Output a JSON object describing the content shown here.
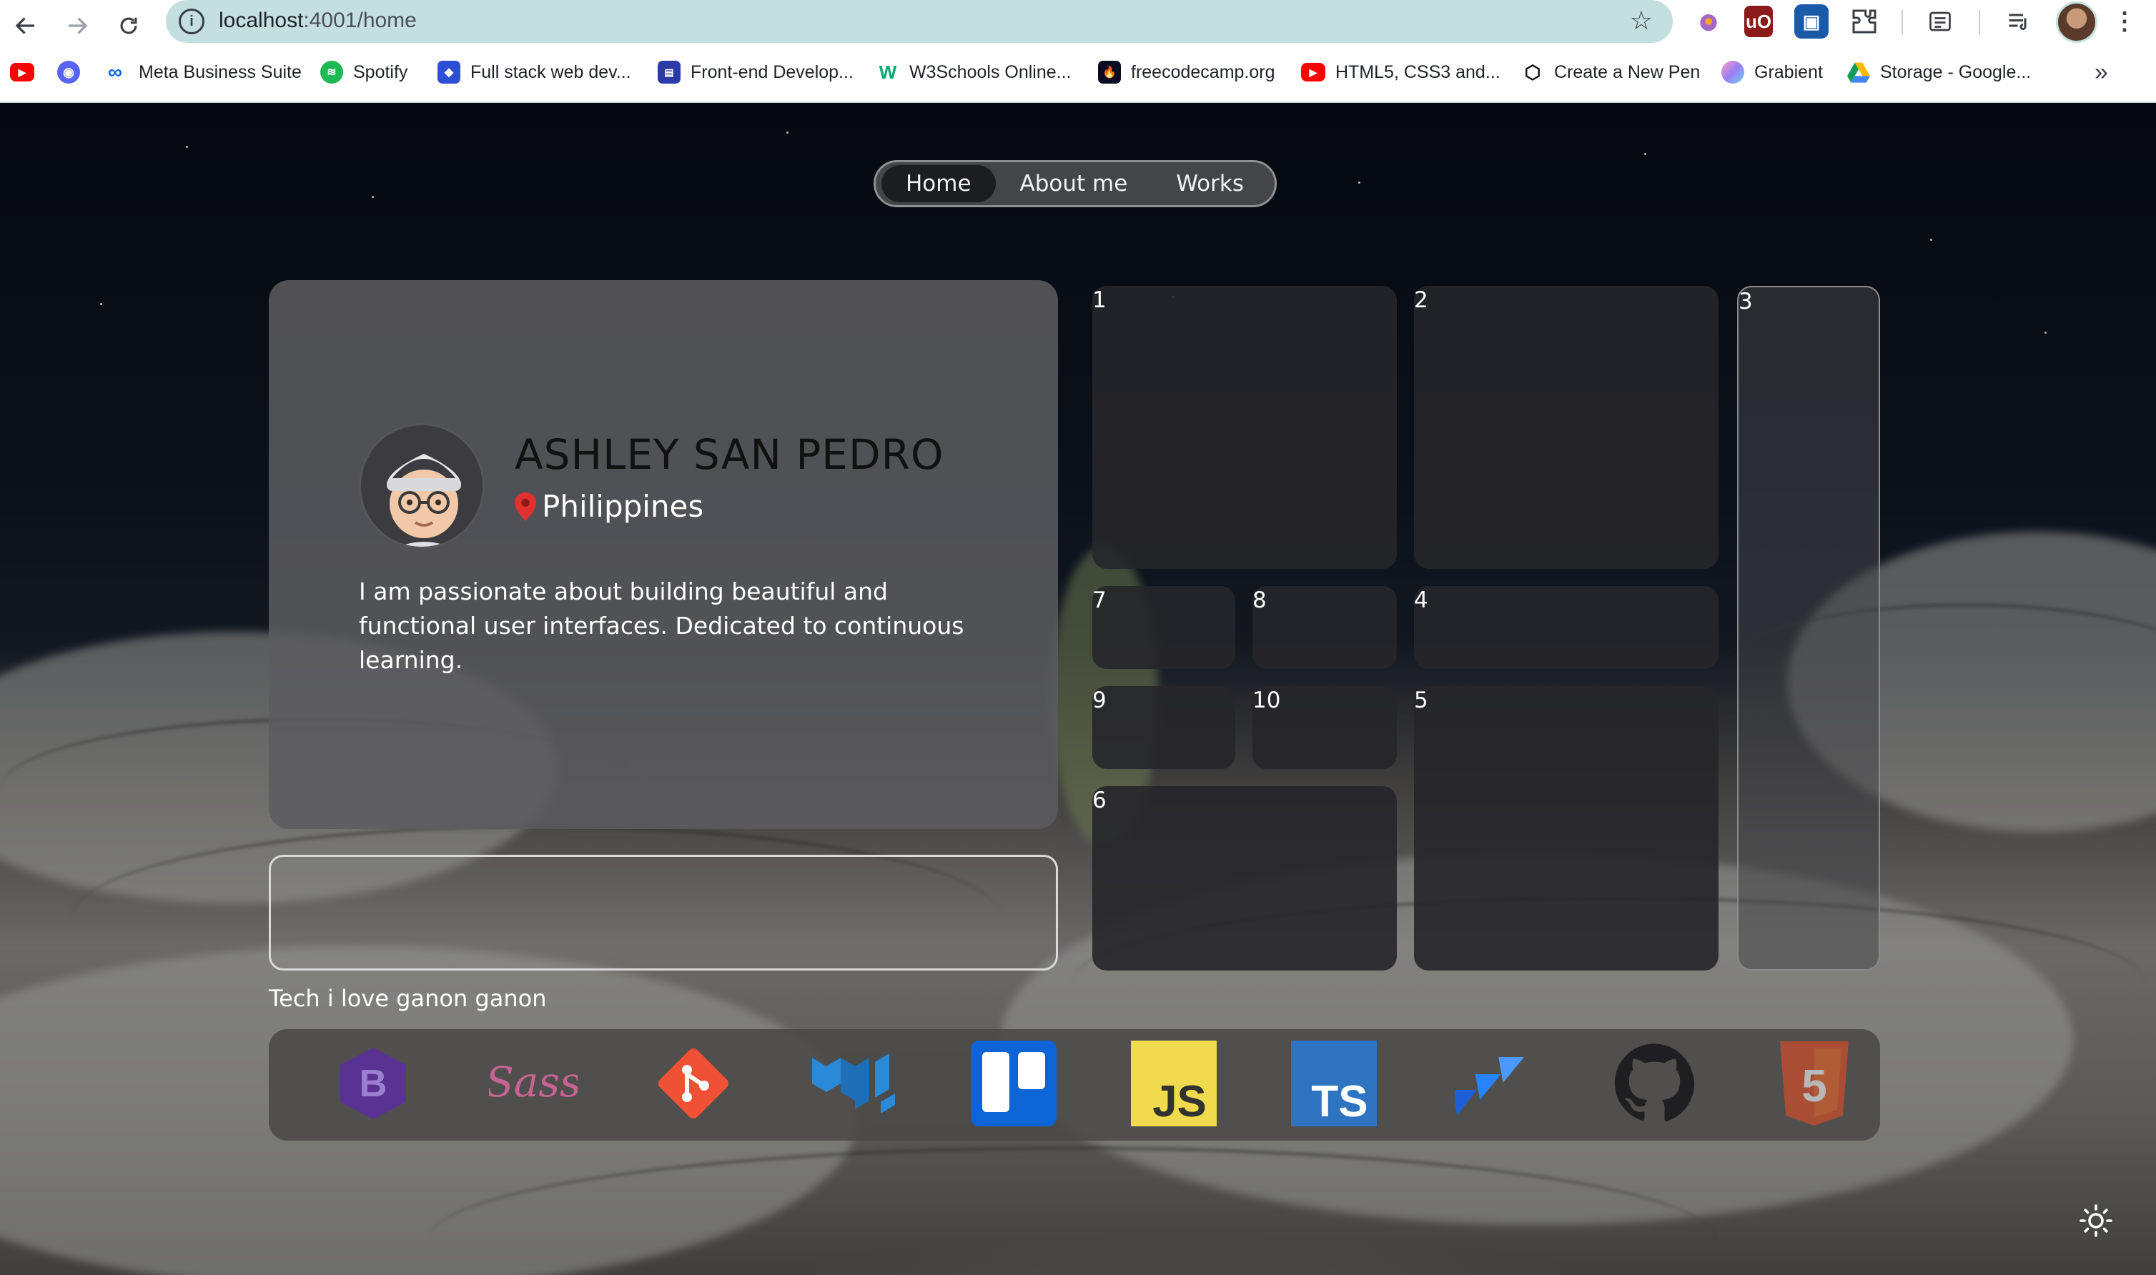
{
  "browser": {
    "url": {
      "host": "localhost",
      "path": ":4001/home"
    },
    "bookmarks": [
      {
        "label": ""
      },
      {
        "label": ""
      },
      {
        "label": "Meta Business Suite"
      },
      {
        "label": "Spotify"
      },
      {
        "label": "Full stack web dev..."
      },
      {
        "label": "Front-end Develop..."
      },
      {
        "label": "W3Schools Online..."
      },
      {
        "label": "freecodecamp.org"
      },
      {
        "label": "HTML5, CSS3 and..."
      },
      {
        "label": "Create a New Pen"
      },
      {
        "label": "Grabient"
      },
      {
        "label": "Storage - Google..."
      }
    ],
    "more_bookmarks_glyph": "»",
    "icons": {
      "back": "arrow-left-icon",
      "forward": "arrow-right-icon",
      "reload": "reload-icon",
      "site_info": "site-info-icon",
      "bookmark_star": "star-icon",
      "menu": "kebab-menu-icon"
    }
  },
  "nav": {
    "items": [
      {
        "label": "Home",
        "active": true
      },
      {
        "label": "About me",
        "active": false
      },
      {
        "label": "Works",
        "active": false
      }
    ]
  },
  "profile": {
    "name": "ASHLEY SAN PEDRO",
    "location": "Philippines",
    "bio": "I am passionate about building beautiful and functional user interfaces. Dedicated to continuous learning."
  },
  "tiles": [
    "1",
    "2",
    "3",
    "4",
    "5",
    "6",
    "7",
    "8",
    "9",
    "10"
  ],
  "tech": {
    "caption": "Tech i love ganon ganon",
    "items": [
      {
        "name": "bootstrap-icon",
        "label": "B"
      },
      {
        "name": "sass-icon",
        "label": "Sass"
      },
      {
        "name": "git-icon",
        "label": ""
      },
      {
        "name": "material-ui-icon",
        "label": ""
      },
      {
        "name": "trello-icon",
        "label": ""
      },
      {
        "name": "javascript-icon",
        "label": "JS"
      },
      {
        "name": "typescript-icon",
        "label": "TS"
      },
      {
        "name": "jira-icon",
        "label": ""
      },
      {
        "name": "github-icon",
        "label": ""
      },
      {
        "name": "html5-icon",
        "label": "5"
      }
    ]
  },
  "colors": {
    "location_pin": "#e03030",
    "nav_active_bg": "#1c1d20",
    "bootstrap": "#6b3fb0",
    "sass": "#c76494",
    "git": "#f05033",
    "mui": "#2a8ad8",
    "trello": "#0d64d6",
    "javascript": "#f0db4f",
    "typescript": "#2f74c0",
    "jira": "#2684ff",
    "html5": "#e44d26"
  }
}
